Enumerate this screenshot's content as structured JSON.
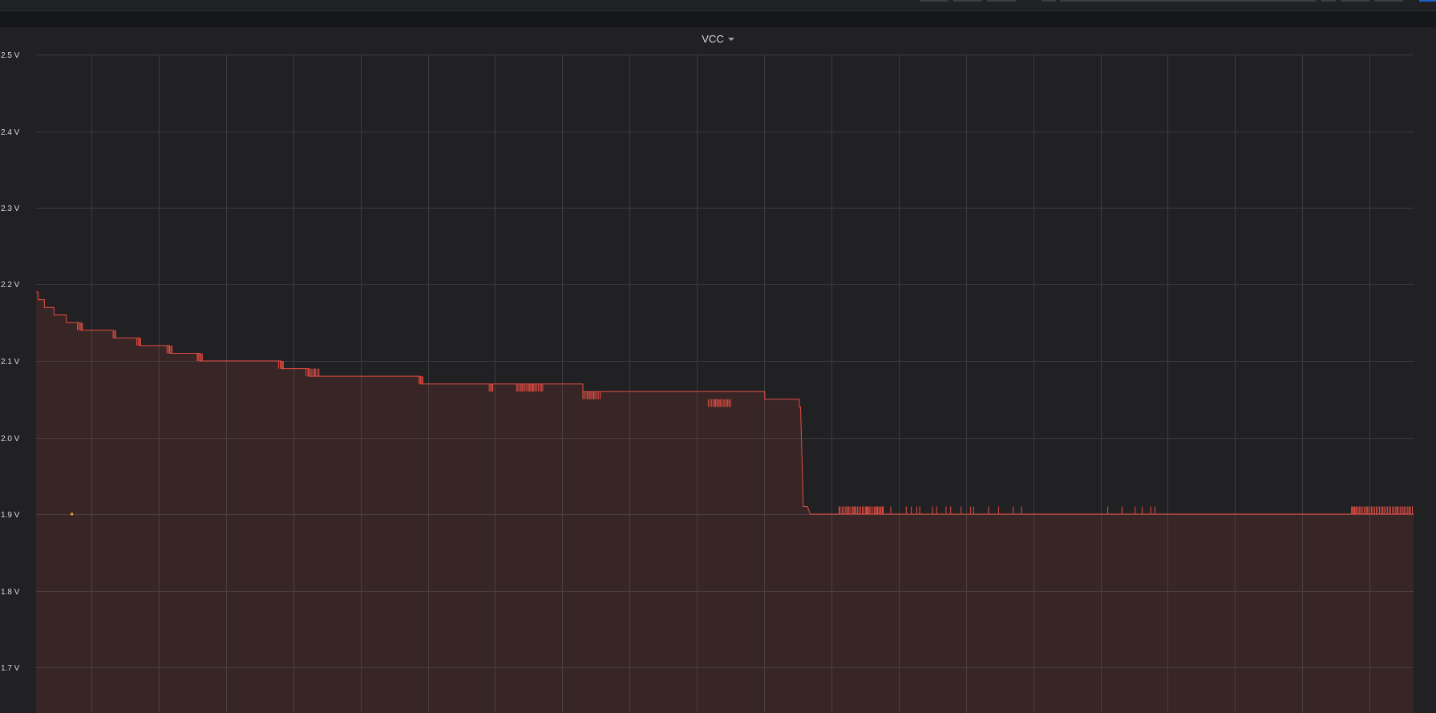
{
  "panel": {
    "title": "VCC"
  },
  "colors": {
    "background": "#161719",
    "panel": "#212124",
    "grid": "#3b3c40",
    "series_line": "#e24d42",
    "series_fill": "#e24d42",
    "annotation_point": "#f2a93b"
  },
  "chart_data": {
    "type": "area",
    "title": "VCC",
    "xlabel": "",
    "ylabel": "",
    "ylim": [
      1.64,
      2.5
    ],
    "y_ticks": [
      1.7,
      1.8,
      1.9,
      2.0,
      2.1,
      2.2,
      2.3,
      2.4,
      2.5
    ],
    "y_tick_labels": [
      "1.7 V",
      "1.8 V",
      "1.9 V",
      "2.0 V",
      "2.1 V",
      "2.2 V",
      "2.3 V",
      "2.4 V",
      "2.5 V"
    ],
    "x_unit": "fraction of visible time range",
    "grid": true,
    "legend": "none",
    "series": [
      {
        "values_description": "stepwise voltage (V)",
        "x": [
          0.0,
          0.0015,
          0.0015,
          0.006,
          0.006,
          0.013,
          0.013,
          0.022,
          0.022,
          0.032,
          0.032,
          0.056,
          0.056,
          0.075,
          0.075,
          0.097,
          0.097,
          0.119,
          0.119,
          0.178,
          0.178,
          0.198,
          0.198,
          0.279,
          0.279,
          0.397,
          0.397,
          0.529,
          0.529,
          0.554,
          0.554,
          0.555,
          0.557,
          0.56,
          0.562,
          1.0
        ],
        "y": [
          2.19,
          2.19,
          2.18,
          2.18,
          2.17,
          2.17,
          2.16,
          2.16,
          2.15,
          2.15,
          2.14,
          2.14,
          2.13,
          2.13,
          2.12,
          2.12,
          2.11,
          2.11,
          2.1,
          2.1,
          2.09,
          2.09,
          2.08,
          2.08,
          2.07,
          2.07,
          2.06,
          2.06,
          2.05,
          2.05,
          2.04,
          2.04,
          1.91,
          1.91,
          1.9,
          1.9
        ],
        "noise_bursts": [
          {
            "x_from": 0.03,
            "x_to": 0.034,
            "y_low": 2.14,
            "y_high": 2.15
          },
          {
            "x_from": 0.056,
            "x_to": 0.058,
            "y_low": 2.13,
            "y_high": 2.14
          },
          {
            "x_from": 0.073,
            "x_to": 0.077,
            "y_low": 2.12,
            "y_high": 2.13
          },
          {
            "x_from": 0.095,
            "x_to": 0.099,
            "y_low": 2.11,
            "y_high": 2.12
          },
          {
            "x_from": 0.117,
            "x_to": 0.121,
            "y_low": 2.1,
            "y_high": 2.11
          },
          {
            "x_from": 0.176,
            "x_to": 0.18,
            "y_low": 2.09,
            "y_high": 2.1
          },
          {
            "x_from": 0.196,
            "x_to": 0.206,
            "y_low": 2.08,
            "y_high": 2.09
          },
          {
            "x_from": 0.278,
            "x_to": 0.281,
            "y_low": 2.07,
            "y_high": 2.08
          },
          {
            "x_from": 0.329,
            "x_to": 0.332,
            "y_low": 2.06,
            "y_high": 2.07
          },
          {
            "x_from": 0.349,
            "x_to": 0.368,
            "y_low": 2.06,
            "y_high": 2.07
          },
          {
            "x_from": 0.397,
            "x_to": 0.41,
            "y_low": 2.05,
            "y_high": 2.06
          },
          {
            "x_from": 0.488,
            "x_to": 0.505,
            "y_low": 2.04,
            "y_high": 2.05
          },
          {
            "x_from": 0.583,
            "x_to": 0.615,
            "y_low": 1.9,
            "y_high": 1.91
          },
          {
            "x_from": 0.615,
            "x_to": 0.725,
            "y_low": 1.9,
            "y_high": 1.91,
            "sparse": true
          },
          {
            "x_from": 0.778,
            "x_to": 0.818,
            "y_low": 1.9,
            "y_high": 1.91,
            "sparse": true
          },
          {
            "x_from": 0.955,
            "x_to": 1.0,
            "y_low": 1.9,
            "y_high": 1.91
          }
        ]
      }
    ],
    "annotation_point": {
      "x": 0.026,
      "y": 1.9
    }
  }
}
